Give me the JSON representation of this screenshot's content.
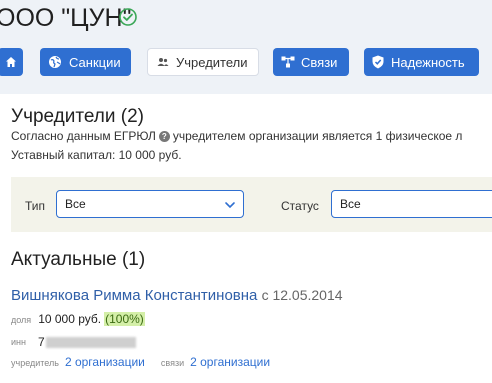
{
  "header": {
    "company_title": "ООО \"ЦУН\"",
    "verified_icon": "check-circle-icon"
  },
  "nav": {
    "home_icon": "home-icon",
    "items": [
      {
        "label": "Санкции",
        "icon": "globe-icon"
      },
      {
        "label": "Учредители",
        "icon": "users-icon",
        "active": true
      },
      {
        "label": "Связи",
        "icon": "network-icon"
      },
      {
        "label": "Надежность",
        "icon": "shield-icon"
      }
    ]
  },
  "founders": {
    "title": "Учредители (2)",
    "egrul_prefix": "Согласно данным ЕГРЮЛ",
    "egrul_suffix": "учредителем организации является 1 физическое л",
    "capital": "Уставный капитал: 10 000 руб."
  },
  "filters": {
    "type_label": "Тип",
    "type_value": "Все",
    "status_label": "Статус",
    "status_value": "Все"
  },
  "current": {
    "title": "Актуальные (1)",
    "person": {
      "name": "Вишнякова Римма Константиновна",
      "since": "с 12.05.2014",
      "share_label": "доля",
      "share_value": "10 000 руб.",
      "share_percent": "(100%)",
      "inn_label": "инн",
      "inn_visible": "7",
      "founder_label": "учредитель",
      "founder_link": "2 организации",
      "links_label": "связи",
      "links_link": "2 организации"
    }
  },
  "colors": {
    "accent": "#2f6fd1",
    "header_bg": "#eef2f7",
    "filter_bg": "#f3f3ea",
    "percent_bg": "#d4efa8"
  }
}
